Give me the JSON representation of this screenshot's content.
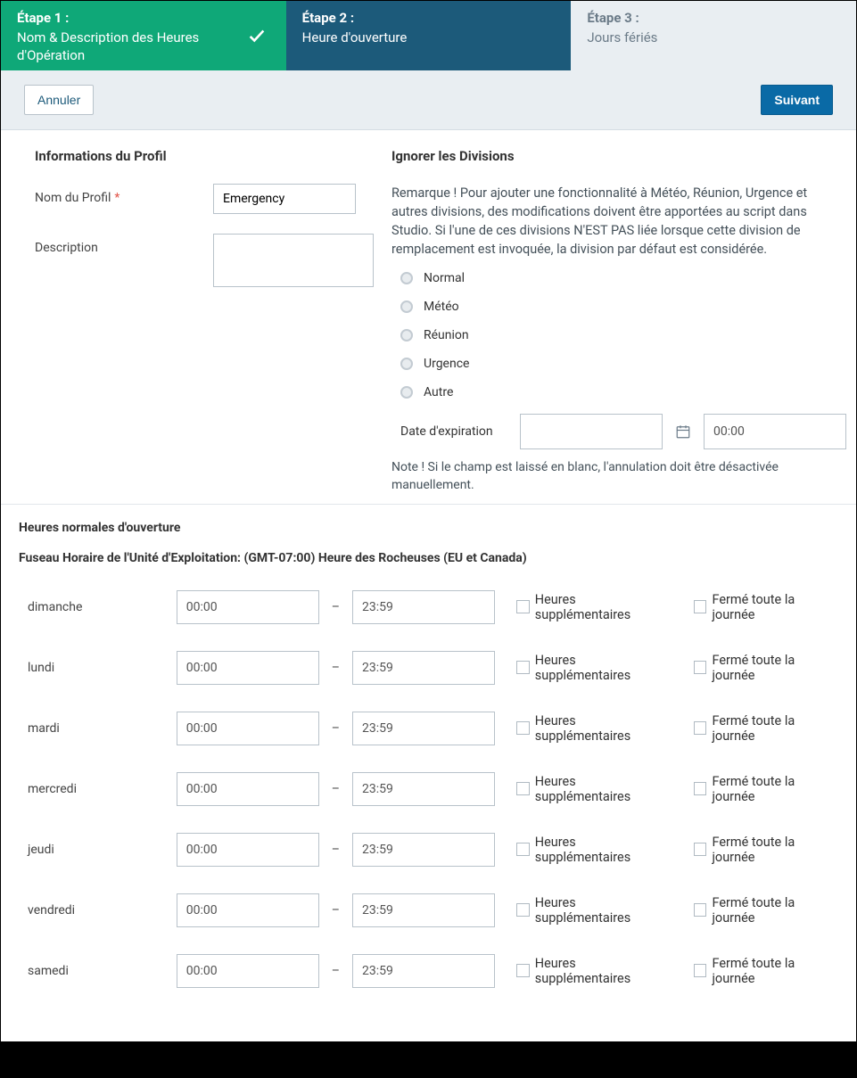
{
  "steps": {
    "s1": {
      "label": "Étape 1 :",
      "title": "Nom & Description des Heures d'Opération"
    },
    "s2": {
      "label": "Étape 2 :",
      "title": "Heure d'ouverture"
    },
    "s3": {
      "label": "Étape 3 :",
      "title": "Jours fériés"
    }
  },
  "actions": {
    "cancel": "Annuler",
    "next": "Suivant"
  },
  "profile": {
    "section": "Informations du Profil",
    "name_label": "Nom du Profil",
    "name_value": "Emergency",
    "desc_label": "Description",
    "desc_value": ""
  },
  "override": {
    "section": "Ignorer les Divisions",
    "note": "Remarque ! Pour ajouter une fonctionnalité à Météo, Réunion, Urgence et autres divisions, des modifications doivent être apportées au script dans Studio. Si l'une de ces divisions N'EST PAS liée lorsque cette division de remplacement est invoquée, la division par défaut est considérée.",
    "options": [
      "Normal",
      "Météo",
      "Réunion",
      "Urgence",
      "Autre"
    ],
    "exp_label": "Date d'expiration",
    "exp_time": "00:00",
    "footnote": "Note ! Si le champ est laissé en blanc, l'annulation doit être désactivée manuellement."
  },
  "hours": {
    "title": "Heures normales d'ouverture",
    "tz": "Fuseau Horaire de l'Unité d'Exploitation: (GMT-07:00) Heure des Rocheuses (EU et Canada)",
    "extra_label": "Heures supplémentaires",
    "closed_label": "Fermé toute la journée",
    "days": [
      {
        "name": "dimanche",
        "start": "00:00",
        "end": "23:59"
      },
      {
        "name": "lundi",
        "start": "00:00",
        "end": "23:59"
      },
      {
        "name": "mardi",
        "start": "00:00",
        "end": "23:59"
      },
      {
        "name": "mercredi",
        "start": "00:00",
        "end": "23:59"
      },
      {
        "name": "jeudi",
        "start": "00:00",
        "end": "23:59"
      },
      {
        "name": "vendredi",
        "start": "00:00",
        "end": "23:59"
      },
      {
        "name": "samedi",
        "start": "00:00",
        "end": "23:59"
      }
    ]
  }
}
